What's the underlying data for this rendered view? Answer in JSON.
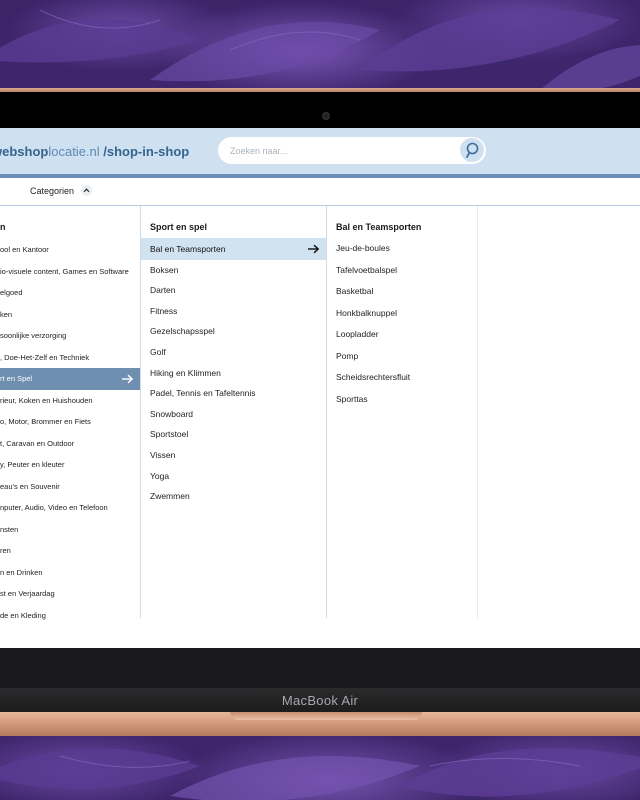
{
  "device": {
    "brand_label": "MacBook Air"
  },
  "header": {
    "logo_bold": "webshop",
    "logo_light": "locatie.nl",
    "logo_suffix": " /shop-in-shop",
    "search_placeholder": "Zoeken naar..."
  },
  "catbar": {
    "label": "Categorien"
  },
  "menu": {
    "col1": {
      "heading": "n",
      "active_index": 6,
      "items": [
        "ool en Kantoor",
        "io-visuele content, Games en Software",
        "elgoed",
        "ken",
        "soonlijke verzorging",
        ", Doe-Het-Zelf en Techniek",
        "rt en Spel",
        "rieur, Koken en Huishouden",
        "o, Motor, Brommer en Fiets",
        "t, Caravan en Outdoor",
        "y, Peuter en kleuter",
        "eau's en Souvenir",
        "nputer, Audio, Video en Telefoon",
        "nsten",
        "ren",
        "n en Drinken",
        "st en Verjaardag",
        "de en Kleding"
      ]
    },
    "col2": {
      "heading": "Sport en spel",
      "active_index": 0,
      "items": [
        "Bal en Teamsporten",
        "Boksen",
        "Darten",
        "Fitness",
        "Gezelschapsspel",
        "Golf",
        "Hiking en Klimmen",
        "Padel, Tennis en Tafeltennis",
        "Snowboard",
        "Sportstoel",
        "Vissen",
        "Yoga",
        "Zwemmen"
      ]
    },
    "col3": {
      "heading": "Bal en Teamsporten",
      "items": [
        "Jeu-de-boules",
        "Tafelvoetbalspel",
        "Basketbal",
        "Honkbalknuppel",
        "Loopladder",
        "Pomp",
        "Scheidsrechtersfluit",
        "Sporttas"
      ]
    }
  },
  "colors": {
    "header_bg": "#cfe0f0",
    "accent_dark": "#6e8fb0",
    "accent_light": "#d1e2f1",
    "logo_color": "#34658f"
  }
}
